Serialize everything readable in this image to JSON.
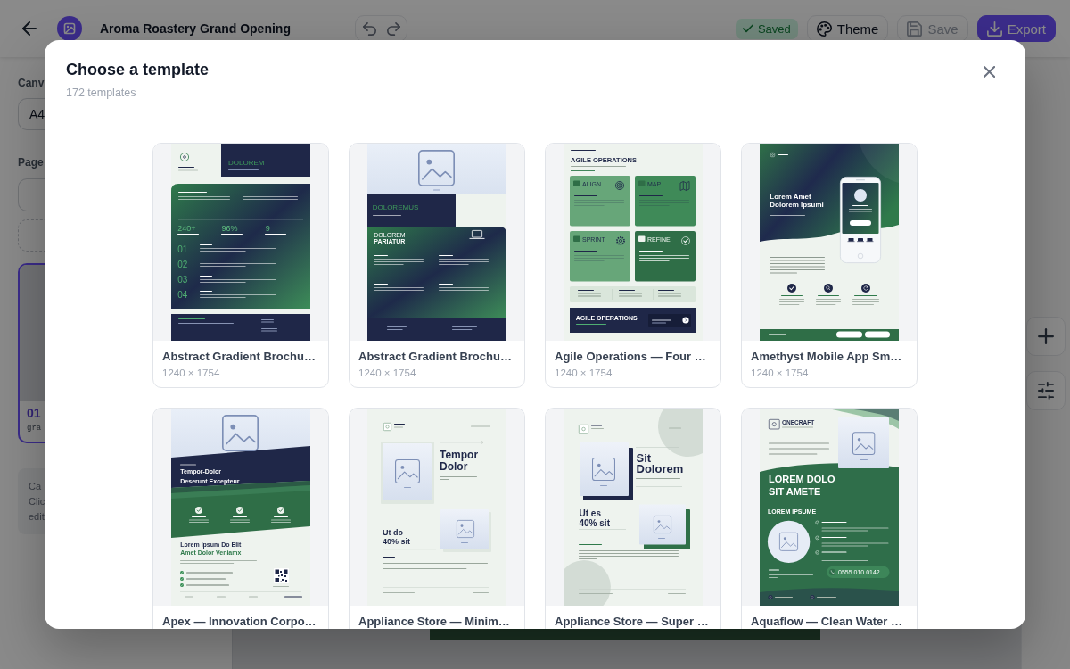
{
  "editor": {
    "title": "Aroma Roastery Grand Opening",
    "status": "Saved",
    "actions": [
      {
        "kind": "theme",
        "label": "Theme",
        "disabled": false
      },
      {
        "kind": "save",
        "label": "Save",
        "disabled": true
      },
      {
        "kind": "export",
        "label": "Export",
        "disabled": false
      }
    ]
  },
  "sidebar": {
    "canvas_label": "Canv",
    "canvas_size": "A4",
    "pages_label": "Page",
    "pages": [
      {
        "number": "01",
        "name": "gra",
        "selected": true
      }
    ],
    "hint_lines": [
      "Ca",
      "Clic",
      "edit"
    ]
  },
  "dialog": {
    "title": "Choose a template",
    "count": "172 templates",
    "templates": [
      {
        "name": "Abstract Gradient Brochu…",
        "size": "1240 × 1754",
        "preview": {
          "kind": "stats",
          "heading": "DOLOREM",
          "stats": [
            "240+",
            "96%",
            "9"
          ],
          "steps": [
            "01",
            "02",
            "03",
            "04"
          ]
        }
      },
      {
        "name": "Abstract Gradient Brochu…",
        "size": "1240 × 1754",
        "preview": {
          "kind": "split",
          "heading": "DOLOREMUS",
          "title_lines": [
            "DOLOREM",
            "PARIATUR"
          ]
        }
      },
      {
        "name": "Agile Operations — Four …",
        "size": "1240 × 1754",
        "preview": {
          "kind": "tiles",
          "heading": "AGILE OPERATIONS",
          "tiles": [
            "ALIGN",
            "MAP",
            "SPRINT",
            "REFINE"
          ],
          "footer": "AGILE OPERATIONS"
        }
      },
      {
        "name": "Amethyst Mobile App Sm…",
        "size": "1240 × 1754",
        "preview": {
          "kind": "app",
          "title_lines": [
            "Lorem Amet",
            "Dolorem Ipsumi"
          ]
        }
      },
      {
        "name": "Apex — Innovation Corpo…",
        "preview": {
          "kind": "slant",
          "title_lines": [
            "Tempor-Dolor",
            "Deserunt Excepteur"
          ],
          "subtitle_lines": [
            "Lorem Ipsum Do Elit",
            "Amet Dolor Veniamx"
          ]
        }
      },
      {
        "name": "Appliance Store — Minim…",
        "preview": {
          "kind": "product",
          "title_lines": [
            "Tempor",
            "Dolor"
          ],
          "offer_lines": [
            "Ut do",
            "40% sit"
          ]
        }
      },
      {
        "name": "Appliance Store — Super …",
        "preview": {
          "kind": "offset",
          "title_lines": [
            "Sit",
            "Dolorem"
          ],
          "offer_lines": [
            "Ut es",
            "40% sit"
          ]
        }
      },
      {
        "name": "Aquaflow — Clean Water …",
        "preview": {
          "kind": "wave",
          "brand": "ONECRAFT",
          "title_lines": [
            "LOREM DOLO",
            "SIT AMETE"
          ],
          "label": "LOREM IPSUME",
          "phone": "0555 010 0142"
        }
      }
    ]
  }
}
